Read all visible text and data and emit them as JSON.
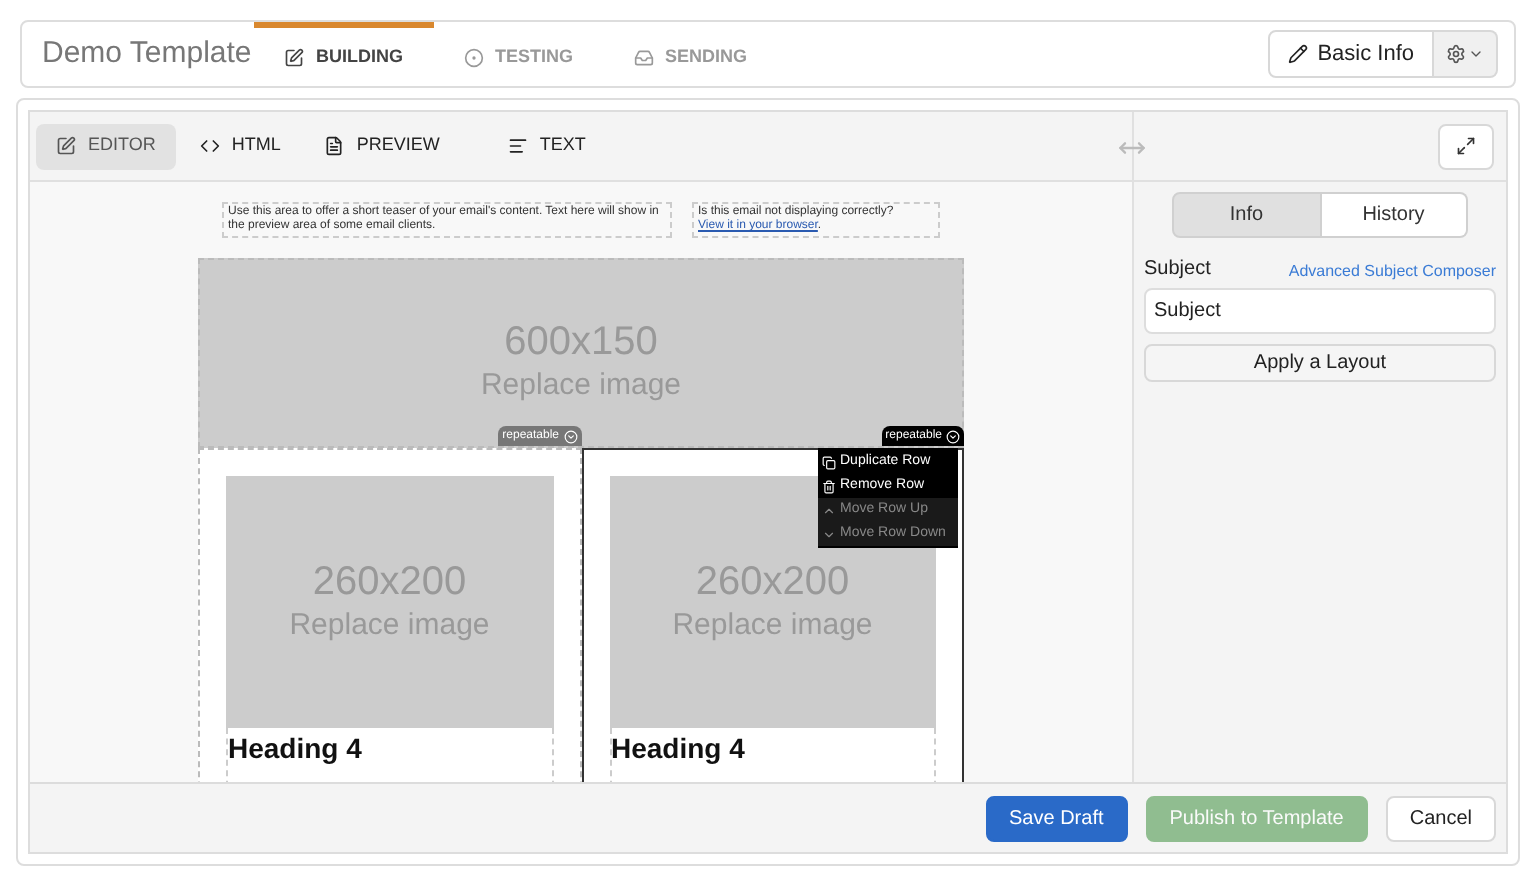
{
  "header": {
    "title": "Demo Template",
    "tabs": [
      {
        "label": "BUILDING",
        "selected": true
      },
      {
        "label": "TESTING",
        "selected": false
      },
      {
        "label": "SENDING",
        "selected": false
      }
    ],
    "basic_info": "Basic Info"
  },
  "editor_tabs": [
    {
      "label": "EDITOR",
      "selected": true
    },
    {
      "label": "HTML",
      "selected": false
    },
    {
      "label": "PREVIEW",
      "selected": false
    },
    {
      "label": "TEXT",
      "selected": false
    }
  ],
  "email": {
    "preheader": "Use this area to offer a short teaser of your email's content. Text here will show in the preview area of some email clients.",
    "view_prompt": "Is this email not displaying correctly?",
    "view_link": "View it in your browser",
    "view_suffix": ".",
    "hero": {
      "size": "600x150",
      "caption": "Replace image"
    },
    "columns": [
      {
        "badge": "repeatable",
        "badge_active": false,
        "image_size": "260x200",
        "image_caption": "Replace image",
        "heading": "Heading 4"
      },
      {
        "badge": "repeatable",
        "badge_active": true,
        "image_size": "260x200",
        "image_caption": "Replace image",
        "heading": "Heading 4"
      }
    ],
    "row_menu": [
      {
        "label": "Duplicate Row",
        "disabled": false
      },
      {
        "label": "Remove Row",
        "disabled": false
      },
      {
        "label": "Move Row Up",
        "disabled": true
      },
      {
        "label": "Move Row Down",
        "disabled": true
      }
    ]
  },
  "side_panel": {
    "toggle": [
      {
        "label": "Info",
        "selected": true
      },
      {
        "label": "History",
        "selected": false
      }
    ],
    "subject_label": "Subject",
    "composer_link": "Advanced Subject Composer",
    "subject_value": "Subject",
    "layout_button": "Apply a Layout"
  },
  "footer": [
    {
      "label": "Save Draft",
      "kind": "primary",
      "disabled": false
    },
    {
      "label": "Publish to Template",
      "kind": "success",
      "disabled": true
    },
    {
      "label": "Cancel",
      "kind": "neutral",
      "disabled": false
    }
  ]
}
